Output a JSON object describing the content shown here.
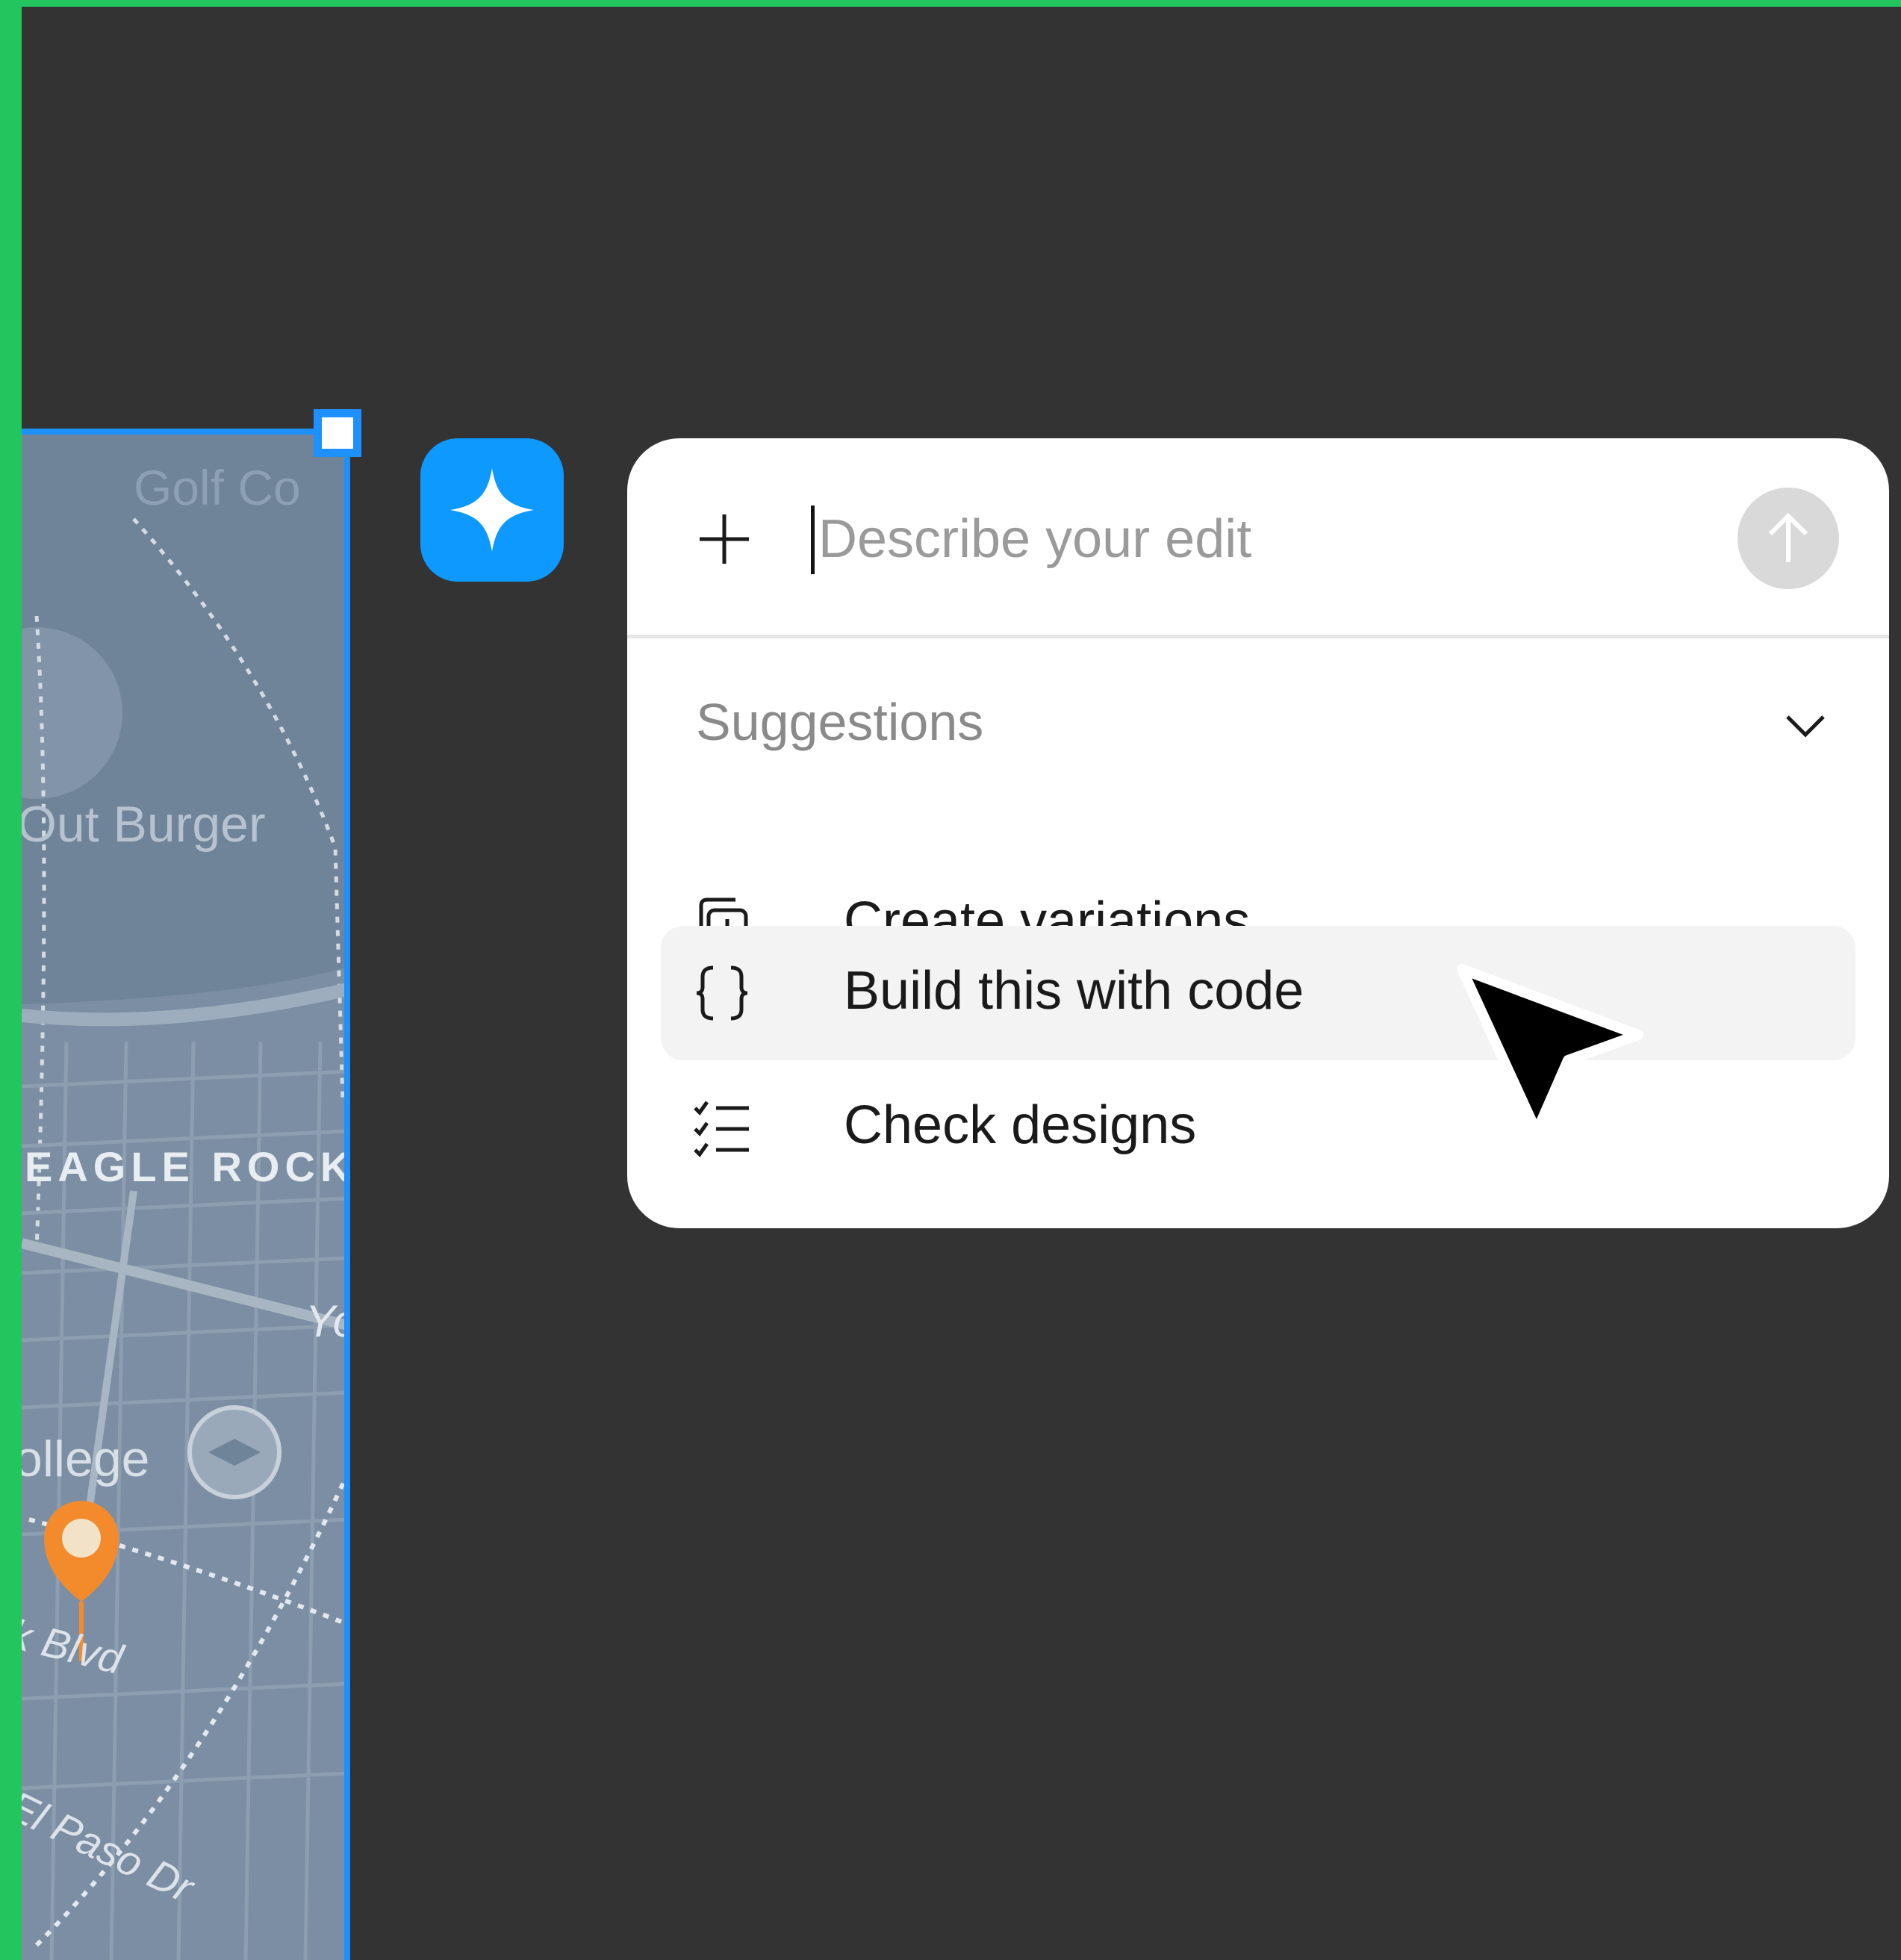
{
  "map": {
    "labels": {
      "burger": "Out Burger",
      "eagle_rock": "EAGLE ROCK",
      "college": "ollege",
      "blvd": "k Blvd",
      "el_paso": "El Paso Dr",
      "yo": "Yo",
      "golf": "Golf Co"
    }
  },
  "ai_button": {
    "icon": "sparkle-icon"
  },
  "panel": {
    "input": {
      "placeholder": "Describe your edit",
      "value": ""
    },
    "suggestions_header": "Suggestions",
    "items": [
      {
        "label": "Create variations",
        "icon": "copy-plus-icon"
      },
      {
        "label": "Build this with code",
        "icon": "code-braces-icon",
        "hovered": true
      },
      {
        "label": "Check designs",
        "icon": "checklist-icon"
      }
    ]
  },
  "colors": {
    "canvas": "#333333",
    "frame_border": "#22c55e",
    "selection": "#1e90ff",
    "ai_button": "#0d99ff"
  }
}
